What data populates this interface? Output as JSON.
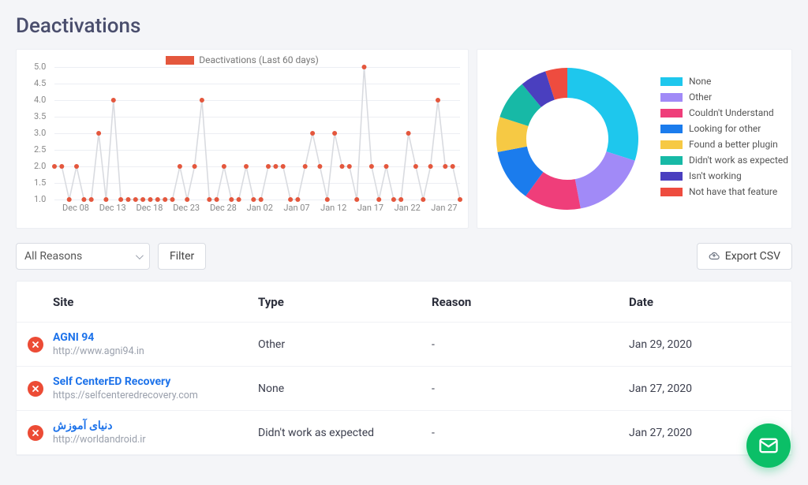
{
  "title": "Deactivations",
  "controls": {
    "reasons_selector": "All Reasons",
    "filter_label": "Filter",
    "export_label": "Export CSV"
  },
  "table": {
    "headers": {
      "site": "Site",
      "type": "Type",
      "reason": "Reason",
      "date": "Date"
    },
    "rows": [
      {
        "site_name": "AGNI 94",
        "site_url": "http://www.agni94.in",
        "type": "Other",
        "reason": "-",
        "date": "Jan 29, 2020"
      },
      {
        "site_name": "Self CenterED Recovery",
        "site_url": "https://selfcenteredrecovery.com",
        "type": "None",
        "reason": "-",
        "date": "Jan 27, 2020"
      },
      {
        "site_name": "دنیای آموزش",
        "site_url": "http://worldandroid.ir",
        "type": "Didn't work as expected",
        "reason": "-",
        "date": "Jan 27, 2020"
      }
    ]
  },
  "chart_data": [
    {
      "id": "line",
      "type": "line",
      "title": "Deactivations (Last 60 days)",
      "ylabel": "Deactivations",
      "ylim": [
        1.0,
        5.0
      ],
      "y_ticks": [
        1.0,
        1.5,
        2.0,
        2.5,
        3.0,
        3.5,
        4.0,
        4.5,
        5.0
      ],
      "categories": [
        "Dec 05",
        "Dec 06",
        "Dec 07",
        "Dec 08",
        "Dec 09",
        "Dec 10",
        "Dec 11",
        "Dec 12",
        "Dec 13",
        "Dec 14",
        "Dec 15",
        "Dec 16",
        "Dec 17",
        "Dec 18",
        "Dec 19",
        "Dec 20",
        "Dec 21",
        "Dec 22",
        "Dec 23",
        "Dec 24",
        "Dec 25",
        "Dec 26",
        "Dec 27",
        "Dec 28",
        "Dec 29",
        "Dec 30",
        "Dec 31",
        "Jan 01",
        "Jan 02",
        "Jan 03",
        "Jan 04",
        "Jan 05",
        "Jan 06",
        "Jan 07",
        "Jan 08",
        "Jan 09",
        "Jan 10",
        "Jan 11",
        "Jan 12",
        "Jan 13",
        "Jan 14",
        "Jan 15",
        "Jan 16",
        "Jan 17",
        "Jan 18",
        "Jan 19",
        "Jan 20",
        "Jan 21",
        "Jan 22",
        "Jan 23",
        "Jan 24",
        "Jan 25",
        "Jan 26",
        "Jan 27",
        "Jan 28",
        "Jan 29"
      ],
      "x_tick_labels": [
        "Dec 08",
        "Dec 13",
        "Dec 18",
        "Dec 23",
        "Dec 28",
        "Jan 02",
        "Jan 07",
        "Jan 12",
        "Jan 17",
        "Jan 22",
        "Jan 27"
      ],
      "x_tick_indices": [
        3,
        8,
        13,
        18,
        23,
        28,
        33,
        38,
        43,
        48,
        53
      ],
      "values": [
        2,
        2,
        1,
        2,
        1,
        1,
        3,
        1,
        4,
        1,
        1,
        1,
        1,
        1,
        1,
        1,
        1,
        2,
        1,
        2,
        4,
        1,
        1,
        2,
        1,
        1,
        2,
        1,
        1,
        2,
        2,
        2,
        1,
        1,
        2,
        3,
        2,
        1,
        3,
        2,
        2,
        1,
        5,
        2,
        1,
        2,
        1,
        1,
        3,
        2,
        1,
        2,
        4,
        2,
        2,
        1
      ],
      "series_color": "#e4573d",
      "grid": true
    },
    {
      "id": "donut",
      "type": "pie",
      "subtype": "donut",
      "series": [
        {
          "name": "None",
          "value": 30,
          "color": "#1ec7ed"
        },
        {
          "name": "Other",
          "value": 17,
          "color": "#a18af7"
        },
        {
          "name": "Couldn't Understand",
          "value": 13,
          "color": "#ef3e7a"
        },
        {
          "name": "Looking for other",
          "value": 12,
          "color": "#1b7ced"
        },
        {
          "name": "Found a better plugin",
          "value": 8,
          "color": "#f6c944"
        },
        {
          "name": "Didn't work as expected",
          "value": 9,
          "color": "#17b9a6"
        },
        {
          "name": "Isn't working",
          "value": 6,
          "color": "#4a3fbf"
        },
        {
          "name": "Not have that feature",
          "value": 5,
          "color": "#ee4c3f"
        }
      ]
    }
  ]
}
